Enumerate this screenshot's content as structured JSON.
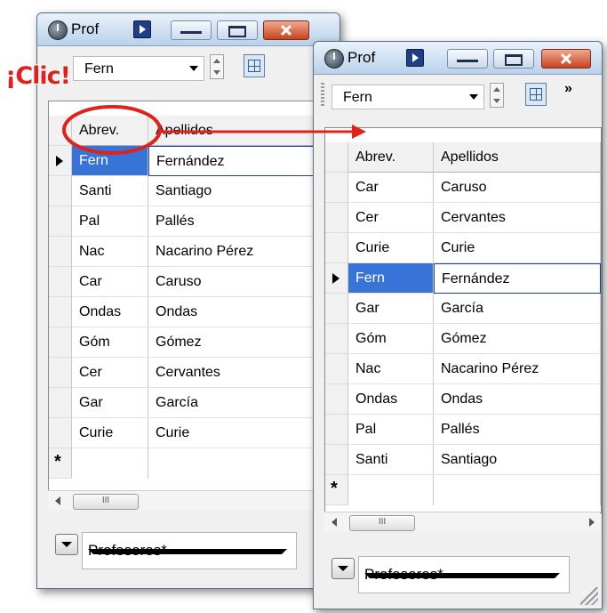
{
  "annotation": {
    "callout": "¡Clic!",
    "color": "#e0211c"
  },
  "left_window": {
    "title": "Prof",
    "toolbar": {
      "combo_value": "Fern"
    },
    "columns": [
      "Abrev.",
      "Apellidos"
    ],
    "rows": [
      {
        "abbr": "Fern",
        "name": "Fernández",
        "current": true
      },
      {
        "abbr": "Santi",
        "name": "Santiago"
      },
      {
        "abbr": "Pal",
        "name": "Pallés"
      },
      {
        "abbr": "Nac",
        "name": "Nacarino Pérez"
      },
      {
        "abbr": "Car",
        "name": "Caruso"
      },
      {
        "abbr": "Ondas",
        "name": "Ondas"
      },
      {
        "abbr": "Góm",
        "name": "Gómez"
      },
      {
        "abbr": "Cer",
        "name": "Cervantes"
      },
      {
        "abbr": "Gar",
        "name": "García"
      },
      {
        "abbr": "Curie",
        "name": "Curie"
      }
    ],
    "new_row_marker": "*",
    "scroll_thumb": "III",
    "footer_value": "Profesores*"
  },
  "right_window": {
    "title": "Prof",
    "toolbar": {
      "combo_value": "Fern",
      "overflow": "»"
    },
    "columns": [
      "Abrev.",
      "Apellidos"
    ],
    "rows": [
      {
        "abbr": "Car",
        "name": "Caruso"
      },
      {
        "abbr": "Cer",
        "name": "Cervantes"
      },
      {
        "abbr": "Curie",
        "name": "Curie"
      },
      {
        "abbr": "Fern",
        "name": "Fernández",
        "current": true
      },
      {
        "abbr": "Gar",
        "name": "García"
      },
      {
        "abbr": "Góm",
        "name": "Gómez"
      },
      {
        "abbr": "Nac",
        "name": "Nacarino Pérez"
      },
      {
        "abbr": "Ondas",
        "name": "Ondas"
      },
      {
        "abbr": "Pal",
        "name": "Pallés"
      },
      {
        "abbr": "Santi",
        "name": "Santiago"
      }
    ],
    "new_row_marker": "*",
    "scroll_thumb": "III",
    "footer_value": "Profesores*"
  }
}
